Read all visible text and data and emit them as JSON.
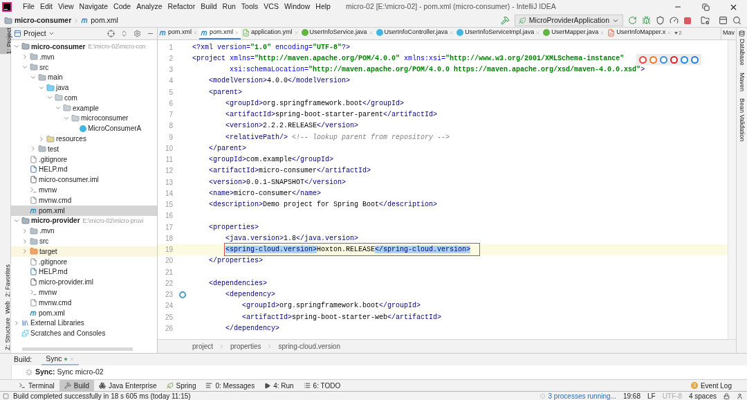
{
  "window": {
    "title": "micro-02 [E:\\micro-02] - pom.xml (micro-consumer) - IntelliJ IDEA"
  },
  "menu": [
    "File",
    "Edit",
    "View",
    "Navigate",
    "Code",
    "Analyze",
    "Refactor",
    "Build",
    "Run",
    "Tools",
    "VCS",
    "Window",
    "Help"
  ],
  "navbar": {
    "crumbs": [
      {
        "label": "micro-consumer",
        "kind": "module"
      },
      {
        "label": "pom.xml",
        "kind": "maven"
      }
    ],
    "run_config": "MicroProviderApplication"
  },
  "left_strip": [
    {
      "label": "1: Project",
      "kind": "project",
      "selected": true
    },
    {
      "label": "2: Favorites",
      "kind": "favorites",
      "selected": false
    },
    {
      "label": "Web",
      "kind": "web",
      "selected": false
    },
    {
      "label": "Z: Structure",
      "kind": "structure",
      "selected": false
    }
  ],
  "right_strip": [
    "Database",
    "Maven",
    "Bean Validation"
  ],
  "project_panel": {
    "title": "Project",
    "tree": [
      {
        "name": "micro-consumer",
        "kind": "module",
        "path": "E:\\micro-02\\micro-con",
        "expanded": true,
        "selected": false,
        "children": [
          {
            "name": ".mvn",
            "kind": "folder",
            "expanded": false,
            "selected": false
          },
          {
            "name": "src",
            "kind": "folder",
            "expanded": true,
            "selected": false,
            "children": [
              {
                "name": "main",
                "kind": "folder",
                "expanded": true,
                "selected": false,
                "children": [
                  {
                    "name": "java",
                    "kind": "source",
                    "expanded": true,
                    "selected": false,
                    "children": [
                      {
                        "name": "com",
                        "kind": "package",
                        "expanded": true,
                        "selected": false,
                        "children": [
                          {
                            "name": "example",
                            "kind": "package",
                            "expanded": true,
                            "selected": false,
                            "children": [
                              {
                                "name": "microconsumer",
                                "kind": "package",
                                "expanded": true,
                                "selected": false,
                                "children": [
                                  {
                                    "name": "MicroConsumerA",
                                    "kind": "class",
                                    "selected": false
                                  }
                                ]
                              }
                            ]
                          }
                        ]
                      }
                    ]
                  },
                  {
                    "name": "resources",
                    "kind": "resources",
                    "expanded": false,
                    "selected": false
                  }
                ]
              },
              {
                "name": "test",
                "kind": "folder",
                "expanded": false,
                "selected": false
              }
            ]
          },
          {
            "name": ".gitignore",
            "kind": "gitignore",
            "selected": false
          },
          {
            "name": "HELP.md",
            "kind": "markdown",
            "selected": false
          },
          {
            "name": "micro-consumer.iml",
            "kind": "iml",
            "selected": false
          },
          {
            "name": "mvnw",
            "kind": "script",
            "selected": false
          },
          {
            "name": "mvnw.cmd",
            "kind": "cmd",
            "selected": false
          },
          {
            "name": "pom.xml",
            "kind": "maven",
            "selected": true
          }
        ]
      },
      {
        "name": "micro-provider",
        "kind": "module",
        "path": "E:\\micro-02\\micro-provi",
        "expanded": true,
        "selected": false,
        "children": [
          {
            "name": ".mvn",
            "kind": "folder",
            "expanded": false,
            "selected": false
          },
          {
            "name": "src",
            "kind": "folder",
            "expanded": false,
            "selected": false
          },
          {
            "name": "target",
            "kind": "excluded",
            "expanded": false,
            "selected": false
          },
          {
            "name": ".gitignore",
            "kind": "gitignore",
            "selected": false
          },
          {
            "name": "HELP.md",
            "kind": "markdown",
            "selected": false
          },
          {
            "name": "micro-provider.iml",
            "kind": "iml",
            "selected": false
          },
          {
            "name": "mvnw",
            "kind": "script",
            "selected": false
          },
          {
            "name": "mvnw.cmd",
            "kind": "cmd",
            "selected": false
          },
          {
            "name": "pom.xml",
            "kind": "maven",
            "selected": false
          }
        ]
      },
      {
        "name": "External Libraries",
        "kind": "libraries",
        "expanded": false,
        "selected": false
      },
      {
        "name": "Scratches and Consoles",
        "kind": "scratches",
        "selected": false
      }
    ]
  },
  "editor": {
    "tabs": [
      {
        "label": "pom.xml",
        "kind": "maven",
        "selected": false
      },
      {
        "label": "pom.xml",
        "kind": "maven",
        "selected": true
      },
      {
        "label": "application.yml",
        "kind": "yaml",
        "selected": false
      },
      {
        "label": "UserInfoService.java",
        "kind": "interface",
        "selected": false
      },
      {
        "label": "UserInfoController.java",
        "kind": "class",
        "selected": false
      },
      {
        "label": "UserInfoServiceImpl.java",
        "kind": "class",
        "selected": false
      },
      {
        "label": "UserMapper.java",
        "kind": "interface",
        "selected": false
      },
      {
        "label": "UserInfoMapper.x",
        "kind": "xml",
        "selected": false
      }
    ],
    "overflow_count": "2",
    "side_tab": "Mav",
    "lines": [
      {
        "number": "1",
        "tokens": [
          {
            "kind": "tag",
            "text": "<?xml"
          },
          {
            "kind": "attr",
            "text": " version="
          },
          {
            "kind": "value",
            "text": "\"1.0\""
          },
          {
            "kind": "attr",
            "text": " encoding="
          },
          {
            "kind": "value",
            "text": "\"UTF-8\""
          },
          {
            "kind": "tag",
            "text": "?>"
          }
        ]
      },
      {
        "number": "2",
        "tokens": [
          {
            "kind": "tag",
            "text": "<project"
          },
          {
            "kind": "attr",
            "text": " xmlns="
          },
          {
            "kind": "value",
            "text": "\"http://maven.apache.org/POM/4.0.0\""
          },
          {
            "kind": "attr",
            "text": " xmlns:xsi="
          },
          {
            "kind": "value",
            "text": "\"http://www.w3.org/2001/XMLSchema-instance\""
          }
        ]
      },
      {
        "number": "3",
        "tokens": [
          {
            "kind": "attr",
            "text": "         xsi:schemaLocation="
          },
          {
            "kind": "value",
            "text": "\"http://maven.apache.org/POM/4.0.0 https://maven.apache.org/xsd/maven-4.0.0.xsd\""
          },
          {
            "kind": "tag",
            "text": ">"
          }
        ]
      },
      {
        "number": "4",
        "tokens": [
          {
            "kind": "tag",
            "text": "    <modelVersion>"
          },
          {
            "kind": "text",
            "text": "4.0.0"
          },
          {
            "kind": "tag",
            "text": "</modelVersion>"
          }
        ]
      },
      {
        "number": "5",
        "tokens": [
          {
            "kind": "tag",
            "text": "    <parent>"
          }
        ]
      },
      {
        "number": "6",
        "tokens": [
          {
            "kind": "tag",
            "text": "        <groupId>"
          },
          {
            "kind": "text",
            "text": "org.springframework.boot"
          },
          {
            "kind": "tag",
            "text": "</groupId>"
          }
        ]
      },
      {
        "number": "7",
        "tokens": [
          {
            "kind": "tag",
            "text": "        <artifactId>"
          },
          {
            "kind": "text",
            "text": "spring-boot-starter-parent"
          },
          {
            "kind": "tag",
            "text": "</artifactId>"
          }
        ]
      },
      {
        "number": "8",
        "tokens": [
          {
            "kind": "tag",
            "text": "        <version>"
          },
          {
            "kind": "text",
            "text": "2.2.2.RELEASE"
          },
          {
            "kind": "tag",
            "text": "</version>"
          }
        ]
      },
      {
        "number": "9",
        "tokens": [
          {
            "kind": "tag",
            "text": "        <relativePath/>"
          },
          {
            "kind": "comment",
            "text": " <!-- lookup parent from repository -->"
          }
        ]
      },
      {
        "number": "10",
        "tokens": [
          {
            "kind": "tag",
            "text": "    </parent>"
          }
        ]
      },
      {
        "number": "11",
        "tokens": [
          {
            "kind": "tag",
            "text": "    <groupId>"
          },
          {
            "kind": "text",
            "text": "com.example"
          },
          {
            "kind": "tag",
            "text": "</groupId>"
          }
        ]
      },
      {
        "number": "12",
        "tokens": [
          {
            "kind": "tag",
            "text": "    <artifactId>"
          },
          {
            "kind": "text",
            "text": "micro-consumer"
          },
          {
            "kind": "tag",
            "text": "</artifactId>"
          }
        ]
      },
      {
        "number": "13",
        "tokens": [
          {
            "kind": "tag",
            "text": "    <version>"
          },
          {
            "kind": "text",
            "text": "0.0.1-SNAPSHOT"
          },
          {
            "kind": "tag",
            "text": "</version>"
          }
        ]
      },
      {
        "number": "14",
        "tokens": [
          {
            "kind": "tag",
            "text": "    <name>"
          },
          {
            "kind": "text",
            "text": "micro-consumer"
          },
          {
            "kind": "tag",
            "text": "</name>"
          }
        ]
      },
      {
        "number": "15",
        "tokens": [
          {
            "kind": "tag",
            "text": "    <description>"
          },
          {
            "kind": "text",
            "text": "Demo project for Spring Boot"
          },
          {
            "kind": "tag",
            "text": "</description>"
          }
        ]
      },
      {
        "number": "16"
      },
      {
        "number": "17",
        "tokens": [
          {
            "kind": "tag",
            "text": "    <properties>"
          }
        ]
      },
      {
        "number": "18",
        "tokens": [
          {
            "kind": "tag",
            "text": "        <java.version>"
          },
          {
            "kind": "text",
            "text": "1.8"
          },
          {
            "kind": "tag",
            "text": "</java.version>"
          }
        ]
      },
      {
        "number": "19",
        "current": true,
        "boxed": true,
        "tokens": [
          {
            "kind": "matched-tag",
            "text": "        <spring-cloud.version>"
          },
          {
            "kind": "text",
            "text": "Hoxton.RELEASE"
          },
          {
            "kind": "matched-tag",
            "text": "</spring-cloud.version>"
          }
        ]
      },
      {
        "number": "20",
        "tokens": [
          {
            "kind": "tag",
            "text": "    </properties>"
          }
        ]
      },
      {
        "number": "21"
      },
      {
        "number": "22",
        "tokens": [
          {
            "kind": "tag",
            "text": "    <dependencies>"
          }
        ]
      },
      {
        "number": "23",
        "marker": true,
        "tokens": [
          {
            "kind": "tag",
            "text": "        <dependency>"
          }
        ]
      },
      {
        "number": "24",
        "tokens": [
          {
            "kind": "tag",
            "text": "            <groupId>"
          },
          {
            "kind": "text",
            "text": "org.springframework.boot"
          },
          {
            "kind": "tag",
            "text": "</groupId>"
          }
        ]
      },
      {
        "number": "25",
        "tokens": [
          {
            "kind": "tag",
            "text": "            <artifactId>"
          },
          {
            "kind": "text",
            "text": "spring-boot-starter-web"
          },
          {
            "kind": "tag",
            "text": "</artifactId>"
          }
        ]
      },
      {
        "number": "26",
        "tokens": [
          {
            "kind": "tag",
            "text": "        </dependency>"
          }
        ]
      }
    ],
    "breadcrumbs": [
      "project",
      "properties",
      "spring-cloud.version"
    ]
  },
  "build_panel": {
    "label": "Build:",
    "tabs": [
      {
        "label": "Sync",
        "selected": true
      }
    ],
    "message": "**Sync:** Sync micro-02"
  },
  "tool_windows": [
    {
      "label": "Terminal",
      "kind": "terminal",
      "selected": false
    },
    {
      "label": "Build",
      "kind": "build",
      "selected": true
    },
    {
      "label": "Java Enterprise",
      "kind": "enterprise",
      "selected": false
    },
    {
      "label": "Spring",
      "kind": "spring",
      "selected": false
    },
    {
      "label": "0: Messages",
      "kind": "messages",
      "selected": false
    },
    {
      "label": "4: Run",
      "kind": "run",
      "selected": false
    },
    {
      "label": "6: TODO",
      "kind": "todo",
      "selected": false
    }
  ],
  "event_log": {
    "label": "Event Log",
    "count": "3"
  },
  "status_bar": {
    "message": "Build completed successfully in 18 s 605 ms (today 11:15)",
    "processes": "3 processes running...",
    "position": "19:68",
    "line_separator": "LF",
    "encoding": "UTF-8",
    "indent": "4 spaces"
  }
}
